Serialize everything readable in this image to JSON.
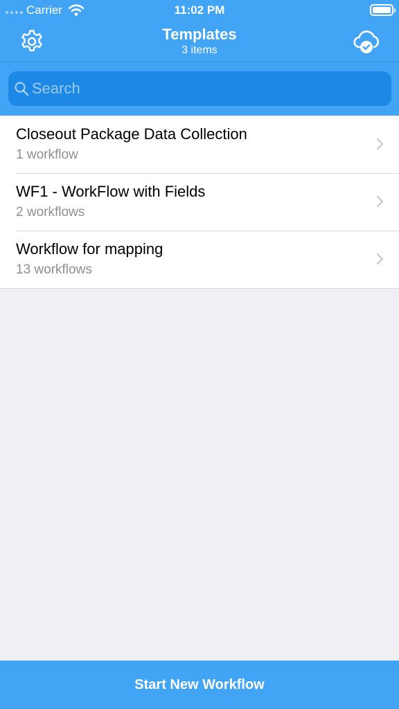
{
  "status_bar": {
    "carrier": "Carrier",
    "time": "11:02 PM"
  },
  "nav": {
    "title": "Templates",
    "subtitle": "3 items",
    "left_icon": "gear-icon",
    "right_icon": "cloud-check-icon"
  },
  "search": {
    "placeholder": "Search",
    "value": ""
  },
  "templates": [
    {
      "title": "Closeout Package Data Collection",
      "subtitle": "1 workflow"
    },
    {
      "title": "WF1 - WorkFlow with Fields",
      "subtitle": "2 workflows"
    },
    {
      "title": "Workflow for mapping",
      "subtitle": "13 workflows"
    }
  ],
  "footer": {
    "button_label": "Start New Workflow"
  },
  "colors": {
    "accent": "#42a4f5",
    "search_bg": "#1d88e6",
    "background": "#efeff4"
  }
}
